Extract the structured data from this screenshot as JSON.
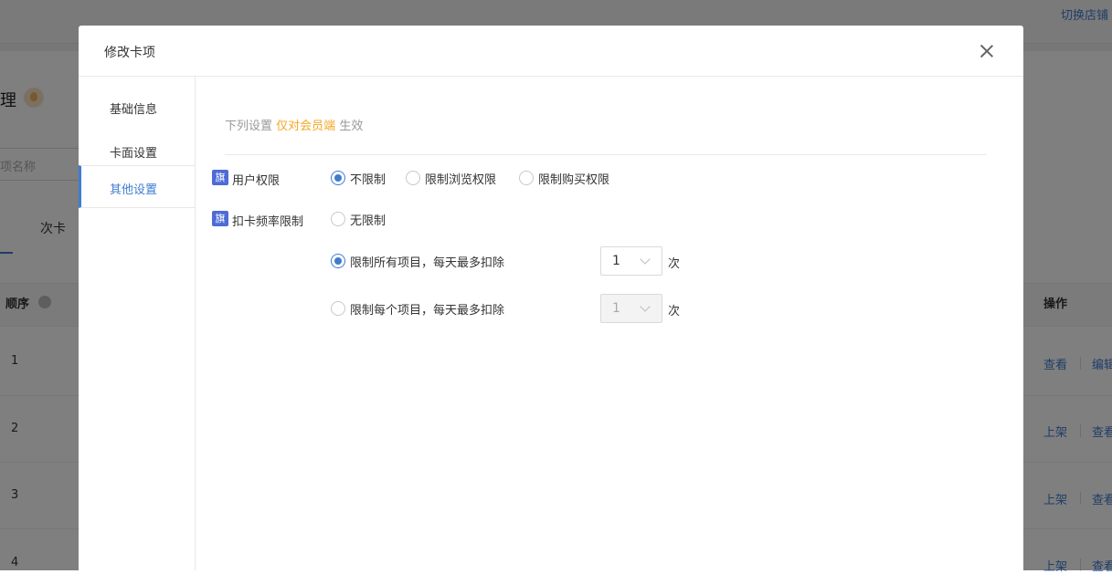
{
  "background": {
    "switch_store": "切换店铺",
    "page_title_fragment": "理",
    "search_placeholder_fragment": "项名称",
    "tab_label": "次卡",
    "col_order": "顺序",
    "col_actions": "操作",
    "rows": [
      {
        "num": "1",
        "action_a": "查看",
        "action_b": "编辑"
      },
      {
        "num": "2",
        "action_a": "上架",
        "action_b": "查看"
      },
      {
        "num": "3",
        "action_a": "上架",
        "action_b": "查看"
      },
      {
        "num": "4",
        "action_a": "上架",
        "action_b": "查看"
      }
    ]
  },
  "modal": {
    "title": "修改卡项",
    "sidebar": [
      {
        "label": "基础信息",
        "active": false
      },
      {
        "label": "卡面设置",
        "active": false
      },
      {
        "label": "其他设置",
        "active": true
      }
    ],
    "note": {
      "prefix": "下列设置",
      "highlight": "仅对会员端",
      "suffix": "生效"
    },
    "badge_text": "旗",
    "user_permission": {
      "label": "用户权限",
      "options": [
        {
          "label": "不限制",
          "checked": true
        },
        {
          "label": "限制浏览权限",
          "checked": false
        },
        {
          "label": "限制购买权限",
          "checked": false
        }
      ]
    },
    "frequency_limit": {
      "label": "扣卡频率限制",
      "opt_none": "无限制",
      "opt_all": "限制所有项目，每天最多扣除",
      "opt_each": "限制每个项目，每天最多扣除",
      "all_value": "1",
      "each_value": "1",
      "unit": "次"
    }
  },
  "colors": {
    "accent": "#3f7cd1",
    "highlight": "#f5a623",
    "badge": "#4e6bd6"
  }
}
